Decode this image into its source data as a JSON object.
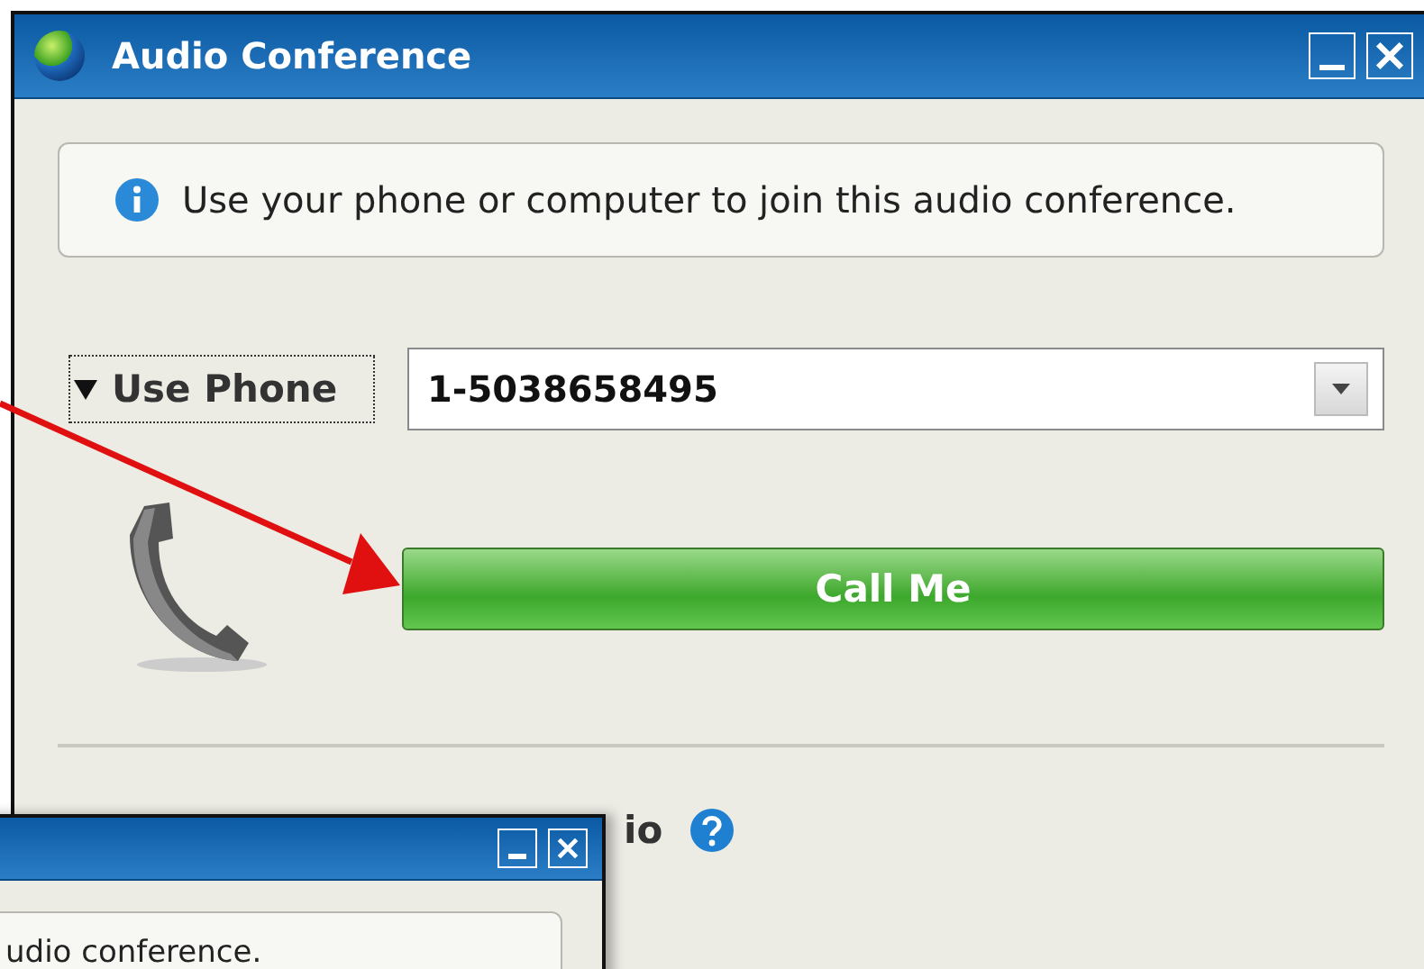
{
  "window": {
    "title": "Audio Conference"
  },
  "info": {
    "text": "Use your phone or computer to join this audio conference."
  },
  "phone_section": {
    "toggle": "Use Phone",
    "expanded": true,
    "number": "1-5038658495",
    "call_button": "Call Me"
  },
  "partial_label": "io",
  "second_window": {
    "info_text": "udio conference."
  }
}
